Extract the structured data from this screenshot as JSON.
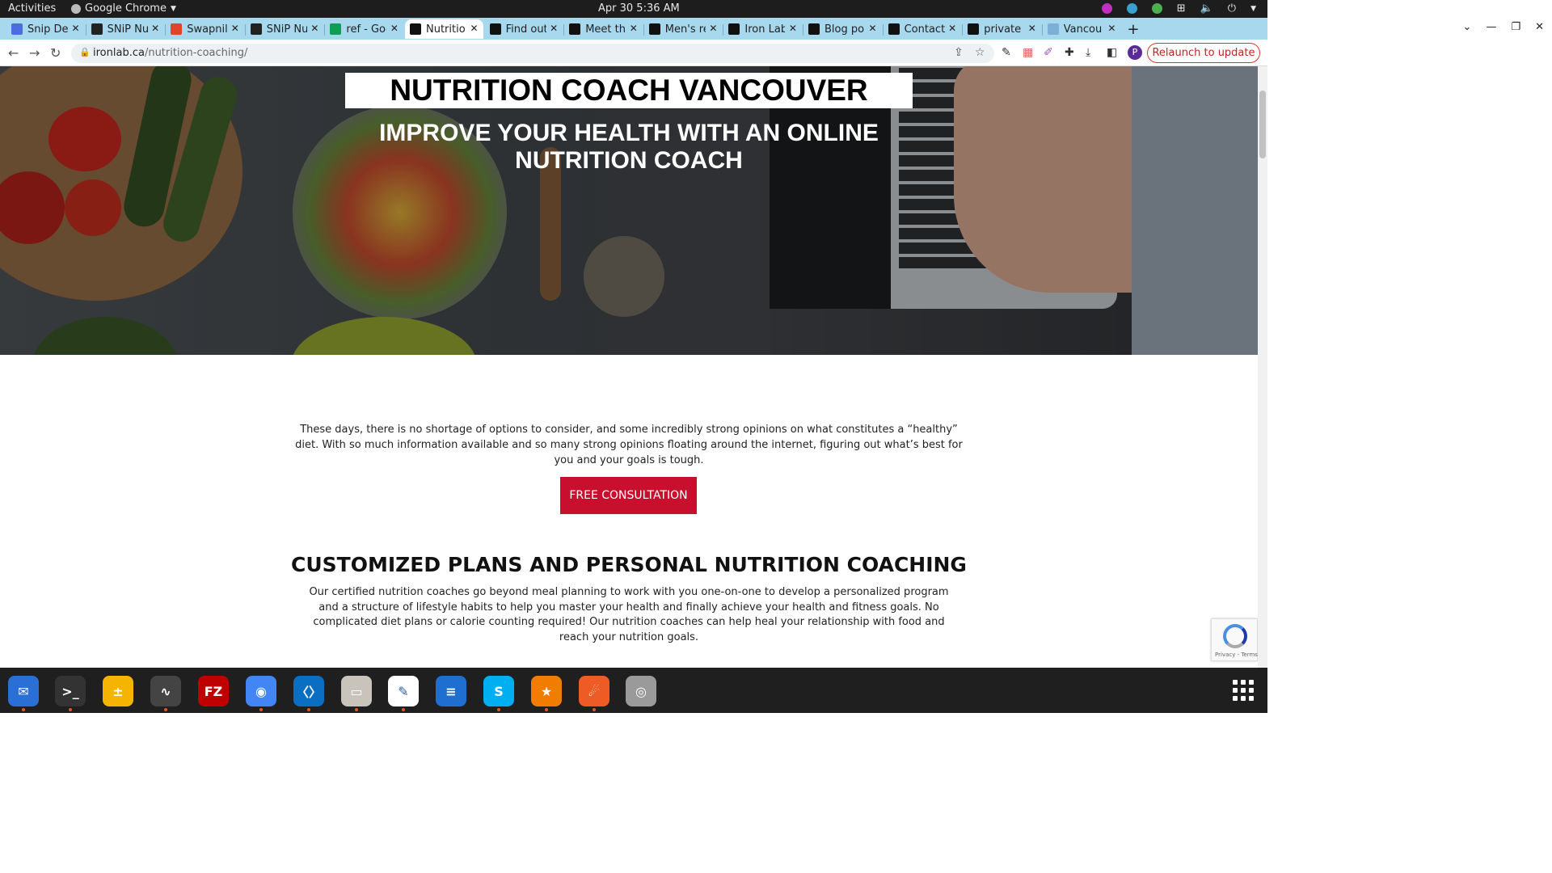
{
  "system_bar": {
    "activities": "Activities",
    "app_name": "Google Chrome",
    "clock": "Apr 30  5:36 AM"
  },
  "tabs": [
    {
      "title": "Snip Det",
      "favicon_color": "#4a6ee0",
      "active": false
    },
    {
      "title": "SNiP Nu",
      "favicon_color": "#222222",
      "active": false
    },
    {
      "title": "Swapnil",
      "favicon_color": "#e24329",
      "active": false
    },
    {
      "title": "SNiP Nu",
      "favicon_color": "#222222",
      "active": false
    },
    {
      "title": "ref - Goo",
      "favicon_color": "#0f9d58",
      "active": false
    },
    {
      "title": "Nutritio",
      "favicon_color": "#111111",
      "active": true
    },
    {
      "title": "Find out",
      "favicon_color": "#111111",
      "active": false
    },
    {
      "title": "Meet the",
      "favicon_color": "#111111",
      "active": false
    },
    {
      "title": "Men's re",
      "favicon_color": "#111111",
      "active": false
    },
    {
      "title": "Iron Lab",
      "favicon_color": "#111111",
      "active": false
    },
    {
      "title": "Blog po",
      "favicon_color": "#111111",
      "active": false
    },
    {
      "title": "Contact",
      "favicon_color": "#111111",
      "active": false
    },
    {
      "title": "private",
      "favicon_color": "#111111",
      "active": false
    },
    {
      "title": "Vancou",
      "favicon_color": "#7db0d6",
      "active": false
    }
  ],
  "toolbar": {
    "url_host": "ironlab.ca",
    "url_path": "/nutrition-coaching/",
    "profile_initial": "P",
    "relaunch_label": "Relaunch to update"
  },
  "page": {
    "hero_title": "NUTRITION COACH VANCOUVER",
    "hero_subtitle": "IMPROVE YOUR HEALTH WITH AN ONLINE NUTRITION COACH",
    "intro": "These days, there is no shortage of options to consider, and some incredibly strong opinions on what constitutes a “healthy” diet. With so much information available and so many strong opinions floating around the internet, figuring out what’s best for you and your goals is tough.",
    "cta_label": "FREE CONSULTATION",
    "section_title": "CUSTOMIZED PLANS AND PERSONAL NUTRITION COACHING",
    "section_body": "Our certified nutrition coaches go beyond meal planning to work with you one-on-one to develop a personalized program and a structure of lifestyle habits to help you master your health and finally achieve your health and fitness goals. No complicated diet plans or calorie counting required! Our nutrition coaches can help heal your relationship with food and reach your nutrition goals.",
    "recaptcha_text": "Privacy - Terms"
  },
  "dock_apps": [
    {
      "name": "thunderbird",
      "color": "#2a6fd6",
      "glyph": "✉"
    },
    {
      "name": "terminal",
      "color": "#333333",
      "glyph": ">_"
    },
    {
      "name": "calculator",
      "color": "#f4b400",
      "glyph": "±"
    },
    {
      "name": "system-monitor",
      "color": "#444444",
      "glyph": "∿"
    },
    {
      "name": "filezilla",
      "color": "#bf0000",
      "glyph": "FZ"
    },
    {
      "name": "chrome",
      "color": "#4285f4",
      "glyph": "◉"
    },
    {
      "name": "vscode",
      "color": "#0a6fc2",
      "glyph": "〈〉"
    },
    {
      "name": "files",
      "color": "#c8c4bc",
      "glyph": "▭"
    },
    {
      "name": "text-editor",
      "color": "#ffffff",
      "glyph": "✎"
    },
    {
      "name": "writer",
      "color": "#1f6fd0",
      "glyph": "≡"
    },
    {
      "name": "skype",
      "color": "#00aff0",
      "glyph": "S"
    },
    {
      "name": "app-flame",
      "color": "#f07c00",
      "glyph": "★"
    },
    {
      "name": "postman",
      "color": "#ef5b25",
      "glyph": "☄"
    },
    {
      "name": "disk-app",
      "color": "#9a9a9a",
      "glyph": "◎"
    }
  ]
}
